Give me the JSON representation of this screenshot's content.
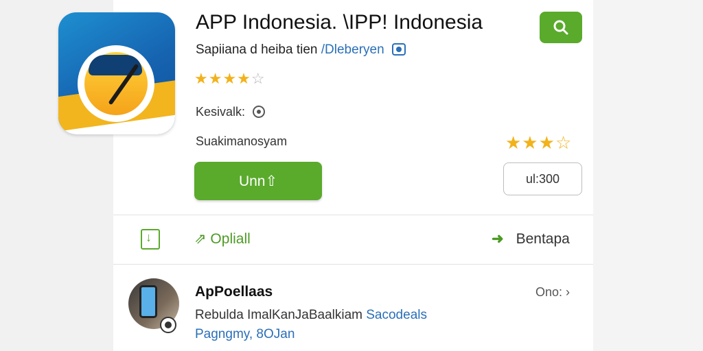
{
  "app": {
    "title": "APP Indonesia. \\IPP! Indonesia",
    "subtitle_prefix": "Sapiiana d heiba tien",
    "developer": "/Dleberyen",
    "rating_top": "★★★★",
    "rating_top_empty": "☆",
    "reviews_label": "Kesivalk:",
    "category": "Suakimanosyam",
    "rating_right": "★★★",
    "rating_right_half": "☆",
    "install_label": "Unn⇧",
    "price_label": "ul:300"
  },
  "actions": {
    "optional_label": "⇗ Opliall",
    "share_arrow": "➜",
    "share_label": "Bentapa"
  },
  "review": {
    "name": "ApPoellaas",
    "date": "Ono: ›",
    "text_prefix": "Rebulda ImalKanJaBaalkiam",
    "text_highlight": "Sacodeals",
    "meta": "Pagngmy, 8OJan"
  },
  "icons": {
    "search": "search-icon",
    "verified": "verified-badge-icon",
    "info": "info-icon",
    "download": "download-icon",
    "share": "share-arrow-icon",
    "chevron": "chevron-right-icon"
  },
  "colors": {
    "accent_green": "#5aaa2c",
    "link_blue": "#2a6fb8",
    "star": "#f2b21b"
  }
}
